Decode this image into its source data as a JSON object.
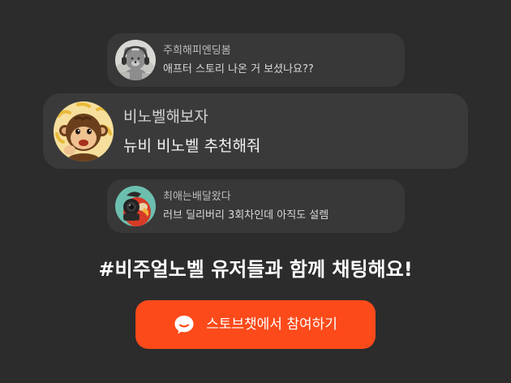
{
  "chats": [
    {
      "nickname": "주희해피엔딩봄",
      "message": "애프터 스토리 나온 거 보셨나요??",
      "avatar_icon": "bear-with-headphones-avatar"
    },
    {
      "nickname": "비노벨해보자",
      "message": "뉴비 비노벨 추천해줘",
      "avatar_icon": "monkey-with-bananas-avatar"
    },
    {
      "nickname": "최애는배달왔다",
      "message": "러브 딜리버리 3회차인데 아직도 설렘",
      "avatar_icon": "parrot-with-camera-avatar"
    }
  ],
  "headline": "#비주얼노벨 유저들과 함께 채팅해요!",
  "cta": {
    "label": "스토브챗에서 참여하기",
    "icon": "chat-bubble-icon",
    "color": "#fc4a1a"
  },
  "colors": {
    "background": "#2c2c2c",
    "chat_bubble": "#383838"
  }
}
